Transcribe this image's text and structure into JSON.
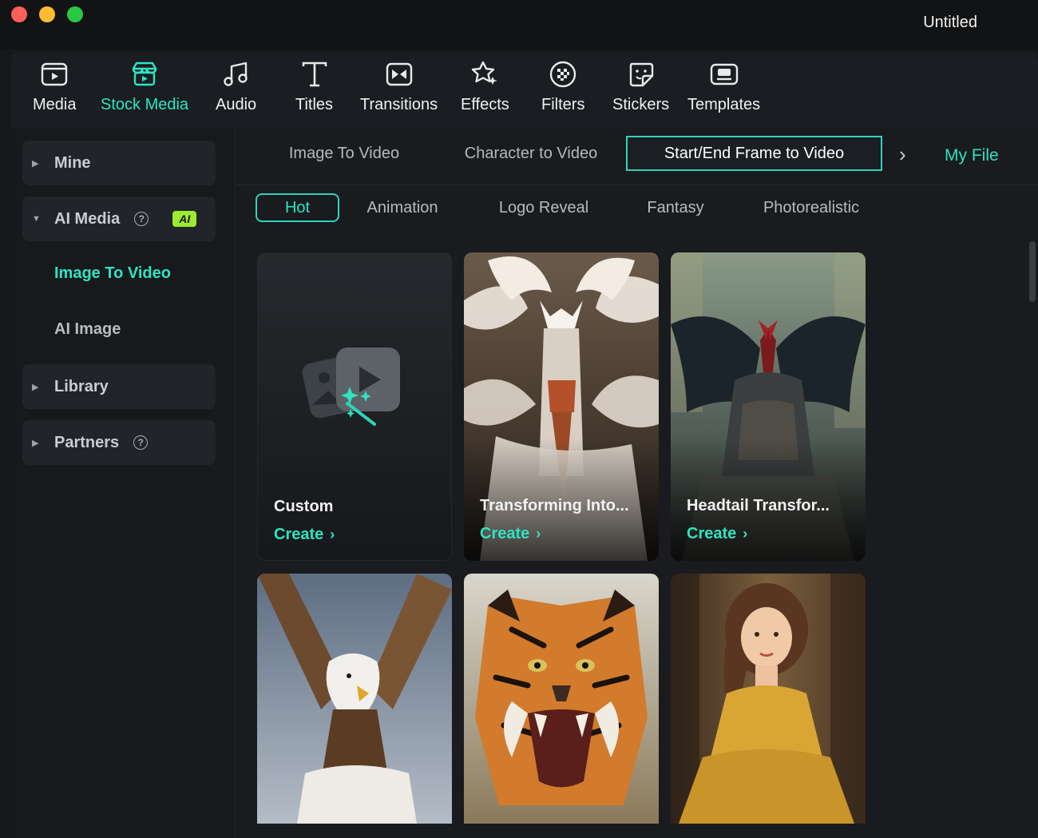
{
  "window": {
    "title": "Untitled"
  },
  "toolbar": {
    "items": [
      {
        "label": "Media",
        "icon": "media-icon"
      },
      {
        "label": "Stock Media",
        "icon": "stock-media-icon",
        "active": true
      },
      {
        "label": "Audio",
        "icon": "audio-icon"
      },
      {
        "label": "Titles",
        "icon": "titles-icon"
      },
      {
        "label": "Transitions",
        "icon": "transitions-icon"
      },
      {
        "label": "Effects",
        "icon": "effects-icon"
      },
      {
        "label": "Filters",
        "icon": "filters-icon"
      },
      {
        "label": "Stickers",
        "icon": "stickers-icon"
      },
      {
        "label": "Templates",
        "icon": "templates-icon"
      }
    ]
  },
  "sidebar": {
    "mine": "Mine",
    "ai_media": "AI Media",
    "ai_badge": "AI",
    "help_glyph": "?",
    "image_to_video": "Image To Video",
    "ai_image": "AI Image",
    "library": "Library",
    "partners": "Partners"
  },
  "tabs": {
    "items": [
      "Image To Video",
      "Character to Video",
      "Start/End Frame to Video"
    ],
    "active_index": 2,
    "more_arrow": "›",
    "my_file": "My File"
  },
  "categories": {
    "items": [
      "Hot",
      "Animation",
      "Logo Reveal",
      "Fantasy",
      "Photorealistic"
    ],
    "active_index": 0
  },
  "cards": [
    {
      "title": "Custom",
      "action": "Create",
      "chevron": "›"
    },
    {
      "title": "Transforming Into...",
      "action": "Create",
      "chevron": "›"
    },
    {
      "title": "Headtail Transfor...",
      "action": "Create",
      "chevron": "›"
    },
    {
      "title": "",
      "action": ""
    },
    {
      "title": "",
      "action": ""
    },
    {
      "title": "",
      "action": ""
    }
  ],
  "colors": {
    "accent": "#2fe3c0",
    "ai_badge": "#9dea2f"
  }
}
